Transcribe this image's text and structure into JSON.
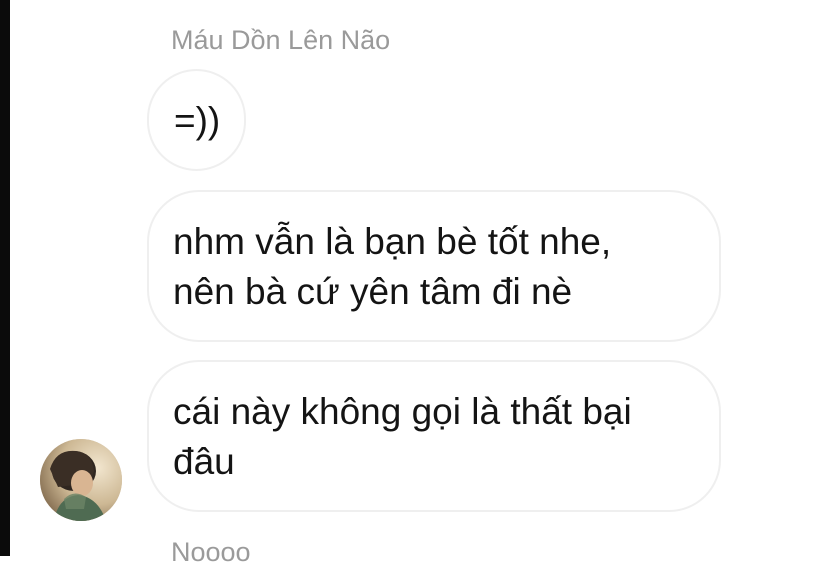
{
  "conversation": {
    "sender_name": "Máu Dồn Lên Não",
    "messages": [
      {
        "lines": [
          "=))"
        ]
      },
      {
        "lines": [
          "nhm vẫn là bạn bè tốt nhe,",
          "nên bà cứ yên tâm đi nè"
        ]
      },
      {
        "lines": [
          "cái này không gọi là thất bại",
          "đâu"
        ]
      }
    ],
    "next_sender_name": "Noooo"
  },
  "colors": {
    "bubble_border": "#efefef",
    "sender_name": "#9a9a9a",
    "message_text": "#141414",
    "left_edge": "#0b0b0b"
  },
  "icons": {
    "avatar": "profile-photo"
  }
}
